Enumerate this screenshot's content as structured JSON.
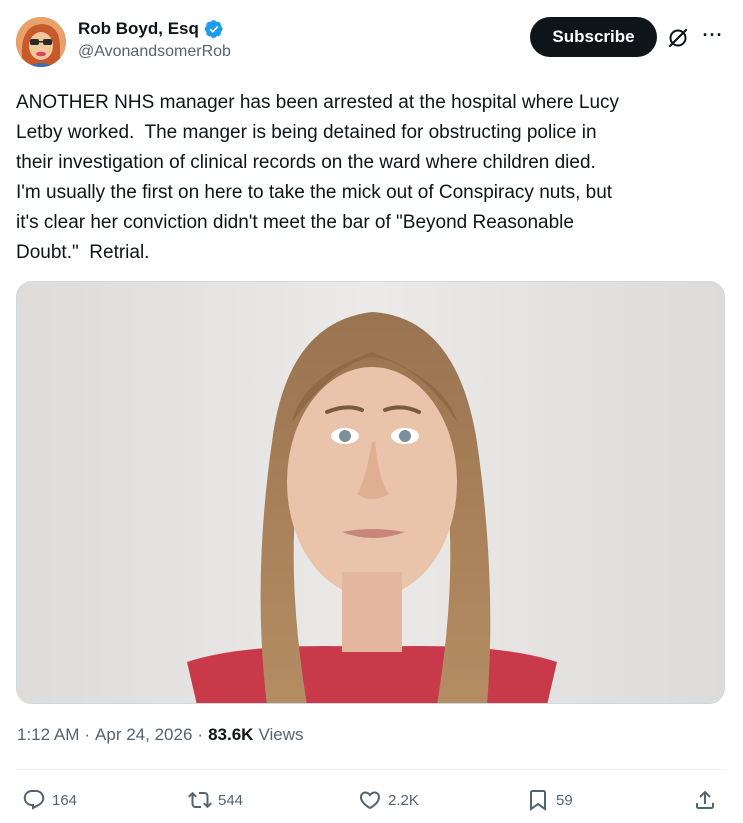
{
  "author": {
    "display_name": "Rob Boyd, Esq",
    "handle": "@AvonandsomerRob",
    "verified": true,
    "avatar_icon": "cartoon-portrait-avatar"
  },
  "header": {
    "subscribe_label": "Subscribe",
    "grok_icon": "grok-icon",
    "more_icon": "more-options-icon",
    "more_glyph": "···"
  },
  "tweet": {
    "text": "ANOTHER NHS manager has been arrested at the hospital where Lucy\nLetby worked.  The manger is being detained for obstructing police in\ntheir investigation of clinical records on the ward where children died.\nI'm usually the first on here to take the mick out of Conspiracy nuts, but\nit's clear her conviction didn't meet the bar of \"Beyond Reasonable\nDoubt.\"  Retrial.",
    "image": "photo-of-woman-portrait"
  },
  "meta": {
    "time": "1:12 AM",
    "separator": "·",
    "date": "Apr 24, 2026",
    "views_count": "83.6K",
    "views_label": "Views"
  },
  "actions": {
    "replies": "164",
    "reposts": "544",
    "likes": "2.2K",
    "bookmarks": "59"
  },
  "colors": {
    "text": "#0f1419",
    "secondary": "#536471",
    "verified_blue": "#1d9bf0",
    "border": "#cfd9de"
  }
}
